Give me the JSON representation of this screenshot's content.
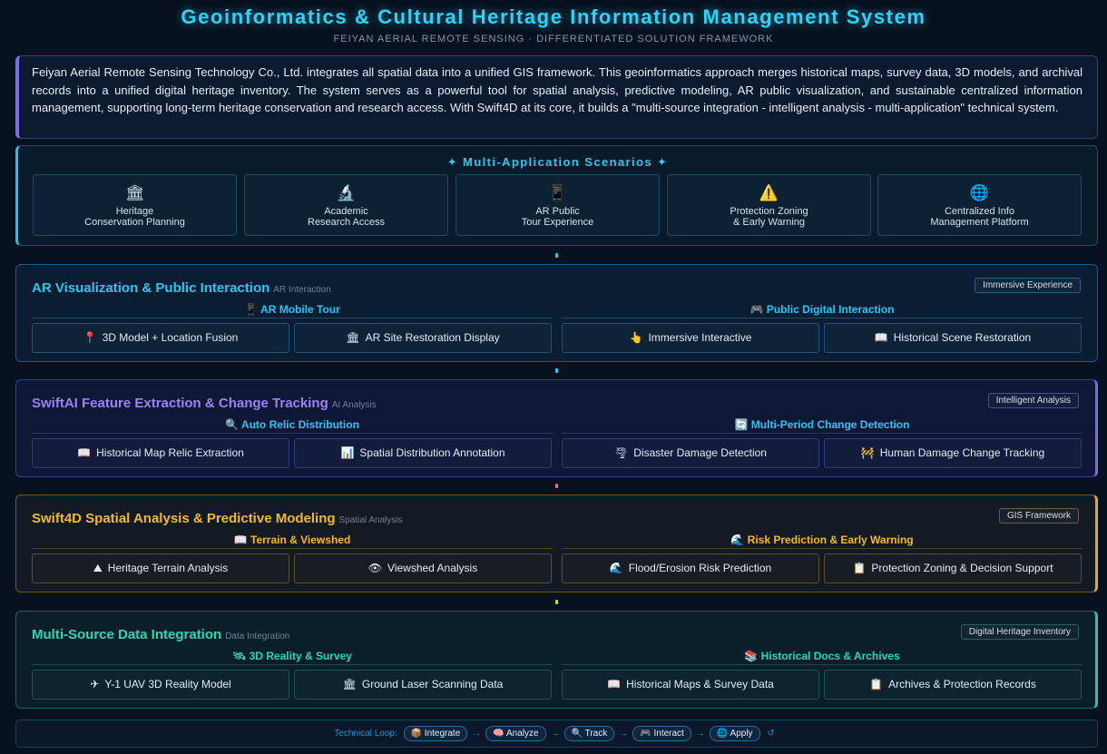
{
  "header": {
    "title": "Geoinformatics & Cultural Heritage Information Management System",
    "subtitle": "FEIYAN AERIAL REMOTE SENSING · DIFFERENTIATED SOLUTION FRAMEWORK"
  },
  "intro": {
    "text": "Feiyan Aerial Remote Sensing Technology Co., Ltd. integrates all spatial data into a unified GIS framework. This geoinformatics approach merges historical maps, survey data, 3D models, and archival records into a unified digital heritage inventory. The system serves as a powerful tool for spatial analysis, predictive modeling, AR public visualization, and sustainable centralized information management, supporting long-term heritage conservation and research access. With Swift4D at its core, it builds a \"multi-source integration - intelligent analysis - multi-application\" technical system."
  },
  "scenarios": {
    "title": "✦ Multi-Application Scenarios ✦",
    "cards": [
      {
        "icon": "🏛",
        "icon_name": "museum-icon",
        "line1": "Heritage",
        "line2": "Conservation Planning"
      },
      {
        "icon": "🔬",
        "icon_name": "microscope-icon",
        "line1": "Academic",
        "line2": "Research Access"
      },
      {
        "icon": "📱",
        "icon_name": "phone-icon",
        "line1": "AR Public",
        "line2": "Tour Experience"
      },
      {
        "icon": "⚠️",
        "icon_name": "warning-icon",
        "line1": "Protection Zoning",
        "line2": "& Early Warning"
      },
      {
        "icon": "🌐",
        "icon_name": "globe-icon",
        "line1": "Centralized Info",
        "line2": "Management Platform"
      }
    ]
  },
  "sections": {
    "ar": {
      "title": "AR Visualization & Public Interaction",
      "tag": "AR Interaction",
      "badge": "Immersive Experience",
      "left_group": {
        "icon": "📱",
        "label": "AR Mobile Tour"
      },
      "right_group": {
        "icon": "🎮",
        "label": "Public Digital Interaction"
      },
      "buttons": [
        {
          "icon": "📍",
          "icon_name": "pin-icon",
          "label": "3D Model + Location Fusion"
        },
        {
          "icon": "🏛",
          "icon_name": "museum-icon",
          "label": "AR Site Restoration Display"
        },
        {
          "icon": "👆",
          "icon_name": "pointing-hand-icon",
          "label": "Immersive Interactive"
        },
        {
          "icon": "📖",
          "icon_name": "book-icon",
          "label": "Historical Scene Restoration"
        }
      ]
    },
    "ai": {
      "title": "SwiftAI Feature Extraction & Change Tracking",
      "tag": "AI Analysis",
      "badge": "Intelligent Analysis",
      "left_group": {
        "icon": "🔍",
        "label": "Auto Relic Distribution"
      },
      "right_group": {
        "icon": "🔄",
        "label": "Multi-Period Change Detection"
      },
      "buttons": [
        {
          "icon": "📖",
          "icon_name": "map-book-icon",
          "label": "Historical Map Relic Extraction"
        },
        {
          "icon": "📊",
          "icon_name": "bar-chart-icon",
          "label": "Spatial Distribution Annotation"
        },
        {
          "icon": "🌪",
          "icon_name": "tornado-icon",
          "label": "Disaster Damage Detection"
        },
        {
          "icon": "🚧",
          "icon_name": "barrier-icon",
          "label": "Human Damage Change Tracking"
        }
      ]
    },
    "s4d": {
      "title": "Swift4D Spatial Analysis & Predictive Modeling",
      "tag": "Spatial Analysis",
      "badge": "GIS Framework",
      "left_group": {
        "icon": "📖",
        "label": "Terrain & Viewshed"
      },
      "right_group": {
        "icon": "🌊",
        "label": "Risk Prediction & Early Warning"
      },
      "buttons": [
        {
          "icon": "⛰",
          "icon_name": "mountain-icon",
          "label": "Heritage Terrain Analysis"
        },
        {
          "icon": "👁",
          "icon_name": "eye-icon",
          "label": "Viewshed Analysis"
        },
        {
          "icon": "🌊",
          "icon_name": "wave-icon",
          "label": "Flood/Erosion Risk Prediction"
        },
        {
          "icon": "📋",
          "icon_name": "clipboard-icon",
          "label": "Protection Zoning & Decision Support"
        }
      ]
    },
    "ms": {
      "title": "Multi-Source Data Integration",
      "tag": "Data Integration",
      "badge": "Digital Heritage Inventory",
      "left_group": {
        "icon": "🛰",
        "label": "3D Reality & Survey"
      },
      "right_group": {
        "icon": "📚",
        "label": "Historical Docs & Archives"
      },
      "buttons": [
        {
          "icon": "✈",
          "icon_name": "airplane-icon",
          "label": "Y-1 UAV 3D Reality Model"
        },
        {
          "icon": "🏛",
          "icon_name": "museum-icon",
          "label": "Ground Laser Scanning Data"
        },
        {
          "icon": "📖",
          "icon_name": "map-book-icon",
          "label": "Historical Maps & Survey Data"
        },
        {
          "icon": "📋",
          "icon_name": "clipboard-icon",
          "label": "Archives & Protection Records"
        }
      ]
    }
  },
  "loop": {
    "label": "Technical Loop:",
    "steps": [
      {
        "icon": "📦",
        "label": "Integrate"
      },
      {
        "icon": "🧠",
        "label": "Analyze"
      },
      {
        "icon": "🔍",
        "label": "Track"
      },
      {
        "icon": "🎮",
        "label": "Interact"
      },
      {
        "icon": "🌐",
        "label": "Apply"
      }
    ],
    "arrow": "→",
    "cycle": "↺"
  },
  "colors": {
    "background": "#07111f",
    "title": "#2fd3f5",
    "ar_accent": "#2cc6ee",
    "ai_accent": "#9b82f5",
    "s4d_accent": "#f2b929",
    "ms_accent": "#2fd6b0"
  }
}
